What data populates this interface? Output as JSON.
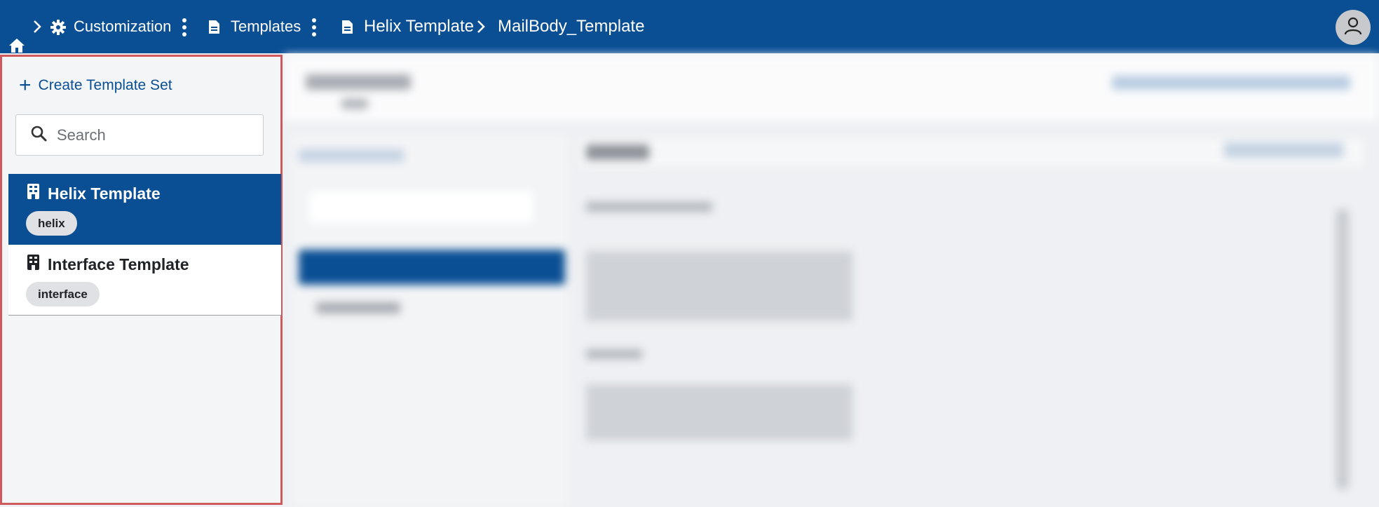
{
  "breadcrumb": {
    "home_icon": "home-icon",
    "items": [
      {
        "label": "Customization",
        "icon": "gear-icon"
      },
      {
        "label": "Templates",
        "icon": "file-icon"
      },
      {
        "label": "Helix Template",
        "icon": "file-icon"
      },
      {
        "label": "MailBody_Template"
      }
    ]
  },
  "user": {
    "avatar_icon": "user-icon"
  },
  "sidebar": {
    "create_label": "Create Template Set",
    "search_placeholder": "Search",
    "items": [
      {
        "title": "Helix Template",
        "tag": "helix",
        "selected": true
      },
      {
        "title": "Interface Template",
        "tag": "interface",
        "selected": false
      }
    ]
  },
  "colors": {
    "brand": "#0a4f94",
    "highlight_border": "#cf5a5e"
  }
}
